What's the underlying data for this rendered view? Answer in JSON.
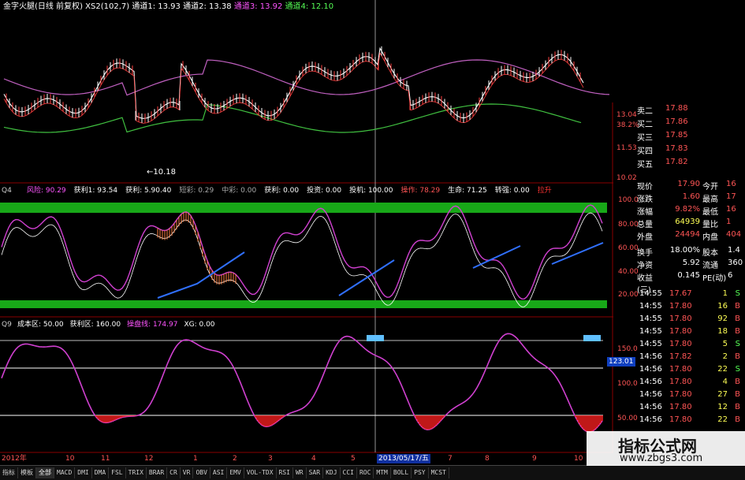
{
  "panel1": {
    "title": "金字火腿(日线 前复权)",
    "xs2": "XS2(102,7)",
    "ch1": "通道1: 13.93",
    "ch2": "通道2: 13.38",
    "ch3": "通道3: 13.92",
    "ch4": "通道4: 12.10",
    "low_label": "←10.18",
    "price_axis": [
      "13.04",
      "38.2%",
      "11.53",
      "10.02"
    ]
  },
  "panel2": {
    "id": "Q4",
    "labels": [
      {
        "text": "风险: 90.29",
        "color": "#ff55ff"
      },
      {
        "text": "获利1: 93.54",
        "color": "#ffffff"
      },
      {
        "text": "获利: 5.90.40",
        "color": "#ffffff"
      },
      {
        "text": "短彩: 0.29",
        "color": "#aaaaaa"
      },
      {
        "text": "中彩: 0.00",
        "color": "#aaaaaa"
      },
      {
        "text": "获利: 0.00",
        "color": "#ffffff"
      },
      {
        "text": "投资: 0.00",
        "color": "#ffffff"
      },
      {
        "text": "投机: 100.00",
        "color": "#ffffff"
      },
      {
        "text": "操作: 78.29",
        "color": "#ff5555"
      },
      {
        "text": "生命: 71.25",
        "color": "#ffffff"
      },
      {
        "text": "转强: 0.00",
        "color": "#ffffff"
      },
      {
        "text": "拉升",
        "color": "#ff3333"
      }
    ],
    "axis": [
      "100.0",
      "80.00",
      "60.00",
      "40.00",
      "20.00"
    ]
  },
  "panel3": {
    "id": "Q9",
    "labels": [
      {
        "text": "成本区: 50.00",
        "color": "#ffffff"
      },
      {
        "text": "获利区: 160.00",
        "color": "#ffffff"
      },
      {
        "text": "操盘线: 174.97",
        "color": "#ff55ff"
      },
      {
        "text": "XG: 0.00",
        "color": "#ffffff"
      }
    ],
    "axis": [
      "150.0",
      "100.0",
      "50.00"
    ],
    "current_value": "123.01"
  },
  "date_axis": [
    "2012年",
    "10",
    "11",
    "12",
    "1",
    "2",
    "3",
    "4",
    "5",
    "2013/05/17/五",
    "7",
    "8",
    "9",
    "10"
  ],
  "order_book": [
    {
      "label": "卖二",
      "price": "17.88"
    },
    {
      "label": "买二",
      "price": "17.86"
    },
    {
      "label": "买三",
      "price": "17.85"
    },
    {
      "label": "买四",
      "price": "17.83"
    },
    {
      "label": "买五",
      "price": "17.82"
    }
  ],
  "quote_stats": [
    {
      "l1": "现价",
      "v1": "17.90",
      "c1": "#ff5555",
      "l2": "今开",
      "v2": "16"
    },
    {
      "l1": "涨跌",
      "v1": "1.60",
      "c1": "#ff5555",
      "l2": "最高",
      "v2": "17"
    },
    {
      "l1": "涨幅",
      "v1": "9.82%",
      "c1": "#ff5555",
      "l2": "最低",
      "v2": "16"
    },
    {
      "l1": "总量",
      "v1": "64939",
      "c1": "#ffff55",
      "l2": "量比",
      "v2": "1"
    },
    {
      "l1": "外盘",
      "v1": "24494",
      "c1": "#ff5555",
      "l2": "内盘",
      "v2": "404"
    }
  ],
  "fund_stats": [
    {
      "l1": "换手",
      "v1": "18.00%",
      "l2": "股本",
      "v2": "1.4"
    },
    {
      "l1": "净资",
      "v1": "5.92",
      "l2": "流通",
      "v2": "360"
    },
    {
      "l1": "收益(三)",
      "v1": "0.145",
      "l2": "PE(动)",
      "v2": "6"
    }
  ],
  "trades": [
    {
      "time": "14:55",
      "price": "17.67",
      "vol": "1",
      "side": "S"
    },
    {
      "time": "14:55",
      "price": "17.80",
      "vol": "16",
      "side": "B"
    },
    {
      "time": "14:55",
      "price": "17.80",
      "vol": "92",
      "side": "B"
    },
    {
      "time": "14:55",
      "price": "17.80",
      "vol": "18",
      "side": "B"
    },
    {
      "time": "14:55",
      "price": "17.80",
      "vol": "5",
      "side": "S"
    },
    {
      "time": "14:56",
      "price": "17.82",
      "vol": "2",
      "side": "B"
    },
    {
      "time": "14:56",
      "price": "17.80",
      "vol": "22",
      "side": "S"
    },
    {
      "time": "14:56",
      "price": "17.80",
      "vol": "4",
      "side": "B"
    },
    {
      "time": "14:56",
      "price": "17.80",
      "vol": "27",
      "side": "B"
    },
    {
      "time": "14:56",
      "price": "17.80",
      "vol": "12",
      "side": "B"
    },
    {
      "time": "14:56",
      "price": "17.80",
      "vol": "22",
      "side": "B"
    }
  ],
  "bottom_tabs": [
    "指标",
    "模板",
    "全部",
    "MACD",
    "DMI",
    "DMA",
    "FSL",
    "TRIX",
    "BRAR",
    "CR",
    "VR",
    "OBV",
    "ASI",
    "EMV",
    "VOL-TDX",
    "RSI",
    "WR",
    "SAR",
    "KDJ",
    "CCI",
    "ROC",
    "MTM",
    "BOLL",
    "PSY",
    "MCST"
  ],
  "watermark": {
    "title": "指标公式网",
    "url": "www.zbgs3.com"
  }
}
